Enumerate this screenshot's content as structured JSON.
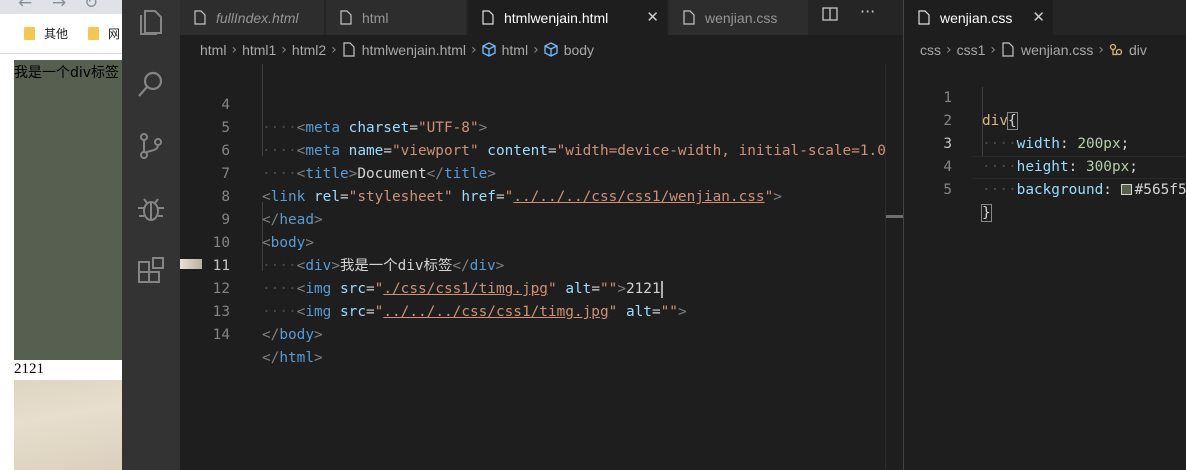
{
  "browser": {
    "bookmarks": [
      {
        "label": "其他",
        "icon": "folder-icon"
      },
      {
        "label": "网",
        "icon": "folder-icon"
      }
    ],
    "div_text": "我是一个div标签",
    "div_background": "#565f50",
    "after_text": "2121"
  },
  "activity_bar": [
    {
      "name": "explorer-icon"
    },
    {
      "name": "search-icon"
    },
    {
      "name": "source-control-icon"
    },
    {
      "name": "debug-icon"
    },
    {
      "name": "extensions-icon"
    }
  ],
  "editor1": {
    "tabs": [
      {
        "label": "fullIndex.html",
        "italic": true,
        "active": false
      },
      {
        "label": "html",
        "italic": false,
        "active": false
      },
      {
        "label": "htmlwenjain.html",
        "italic": false,
        "active": true
      },
      {
        "label": "wenjian.css",
        "italic": false,
        "active": false
      }
    ],
    "breadcrumb": [
      "html",
      "html1",
      "html2",
      "htmlwenjain.html",
      "html",
      "body"
    ],
    "line_numbers": [
      "4",
      "5",
      "6",
      "7",
      "8",
      "9",
      "10",
      "11",
      "12",
      "13",
      "14"
    ],
    "current_line": "11"
  },
  "editor2": {
    "tab_label": "wenjian.css",
    "breadcrumb": [
      "css",
      "css1",
      "wenjian.css",
      "div"
    ],
    "line_numbers": [
      "1",
      "2",
      "3",
      "4",
      "5"
    ],
    "current_line": "3"
  },
  "colors": {
    "accent": "#007acc",
    "swatch": "#565f50"
  }
}
